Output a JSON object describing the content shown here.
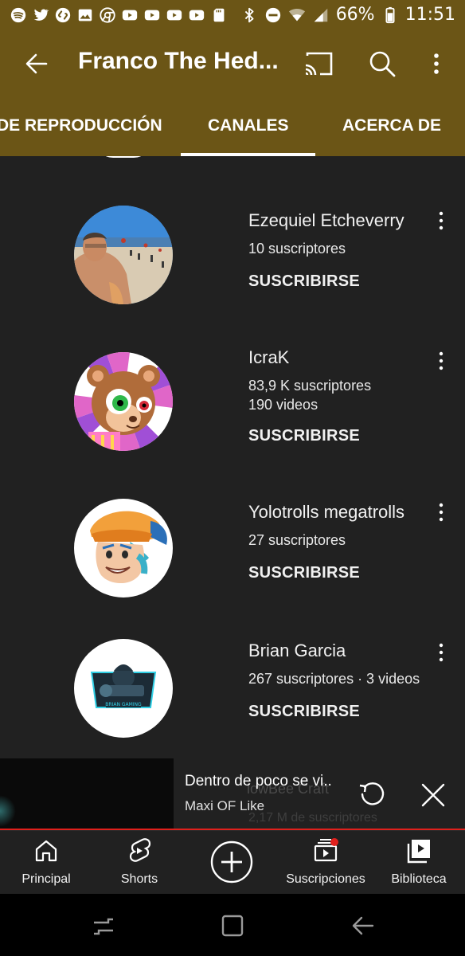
{
  "status_bar": {
    "battery_percent": "66%",
    "time": "11:51",
    "notification_icons": [
      "spotify-icon",
      "twitter-icon",
      "shazam-icon",
      "gallery-icon",
      "chrome-icon",
      "youtube-icon",
      "youtube-icon",
      "youtube-icon",
      "youtube-icon",
      "sd-card-icon"
    ],
    "system_icons": [
      "bluetooth-icon",
      "do-not-disturb-icon",
      "wifi-icon",
      "signal-icon",
      "battery-icon"
    ]
  },
  "app_bar": {
    "title": "Franco The Hed...",
    "icons": [
      "back-arrow-icon",
      "cast-icon",
      "search-icon",
      "more-vert-icon"
    ]
  },
  "tabs": {
    "items": [
      {
        "label": "DE REPRODUCCIÓN"
      },
      {
        "label": "CANALES",
        "active": true
      },
      {
        "label": "ACERCA DE"
      }
    ]
  },
  "channels": [
    {
      "name": "Ezequiel Etcheverry",
      "meta1": "10 suscriptores",
      "meta2": "",
      "subscribe": "SUSCRIBIRSE"
    },
    {
      "name": "IcraK",
      "meta1": "83,9 K suscriptores",
      "meta2": "190 videos",
      "subscribe": "SUSCRIBIRSE"
    },
    {
      "name": "Yolotrolls megatrolls",
      "meta1": "27 suscriptores",
      "meta2": "",
      "subscribe": "SUSCRIBIRSE"
    },
    {
      "name": "Brian Garcia",
      "meta1": "267 suscriptores · 3 videos",
      "meta2": "",
      "subscribe": "SUSCRIBIRSE"
    }
  ],
  "mini_player": {
    "title": "Dentro de poco se vi..",
    "channel": "Maxi OF Like",
    "behind_name": "lowBee Craft",
    "behind_meta": "2,17 M de suscriptores"
  },
  "bottom_nav": {
    "items": [
      {
        "label": "Principal",
        "icon": "home-icon"
      },
      {
        "label": "Shorts",
        "icon": "shorts-icon"
      },
      {
        "label": "",
        "icon": "create-icon"
      },
      {
        "label": "Suscripciones",
        "icon": "subscriptions-icon",
        "notification_dot": true
      },
      {
        "label": "Biblioteca",
        "icon": "library-icon"
      }
    ]
  },
  "colors": {
    "header_bg": "#6b5516",
    "body_bg": "#212121",
    "accent_red": "#e0201c"
  }
}
